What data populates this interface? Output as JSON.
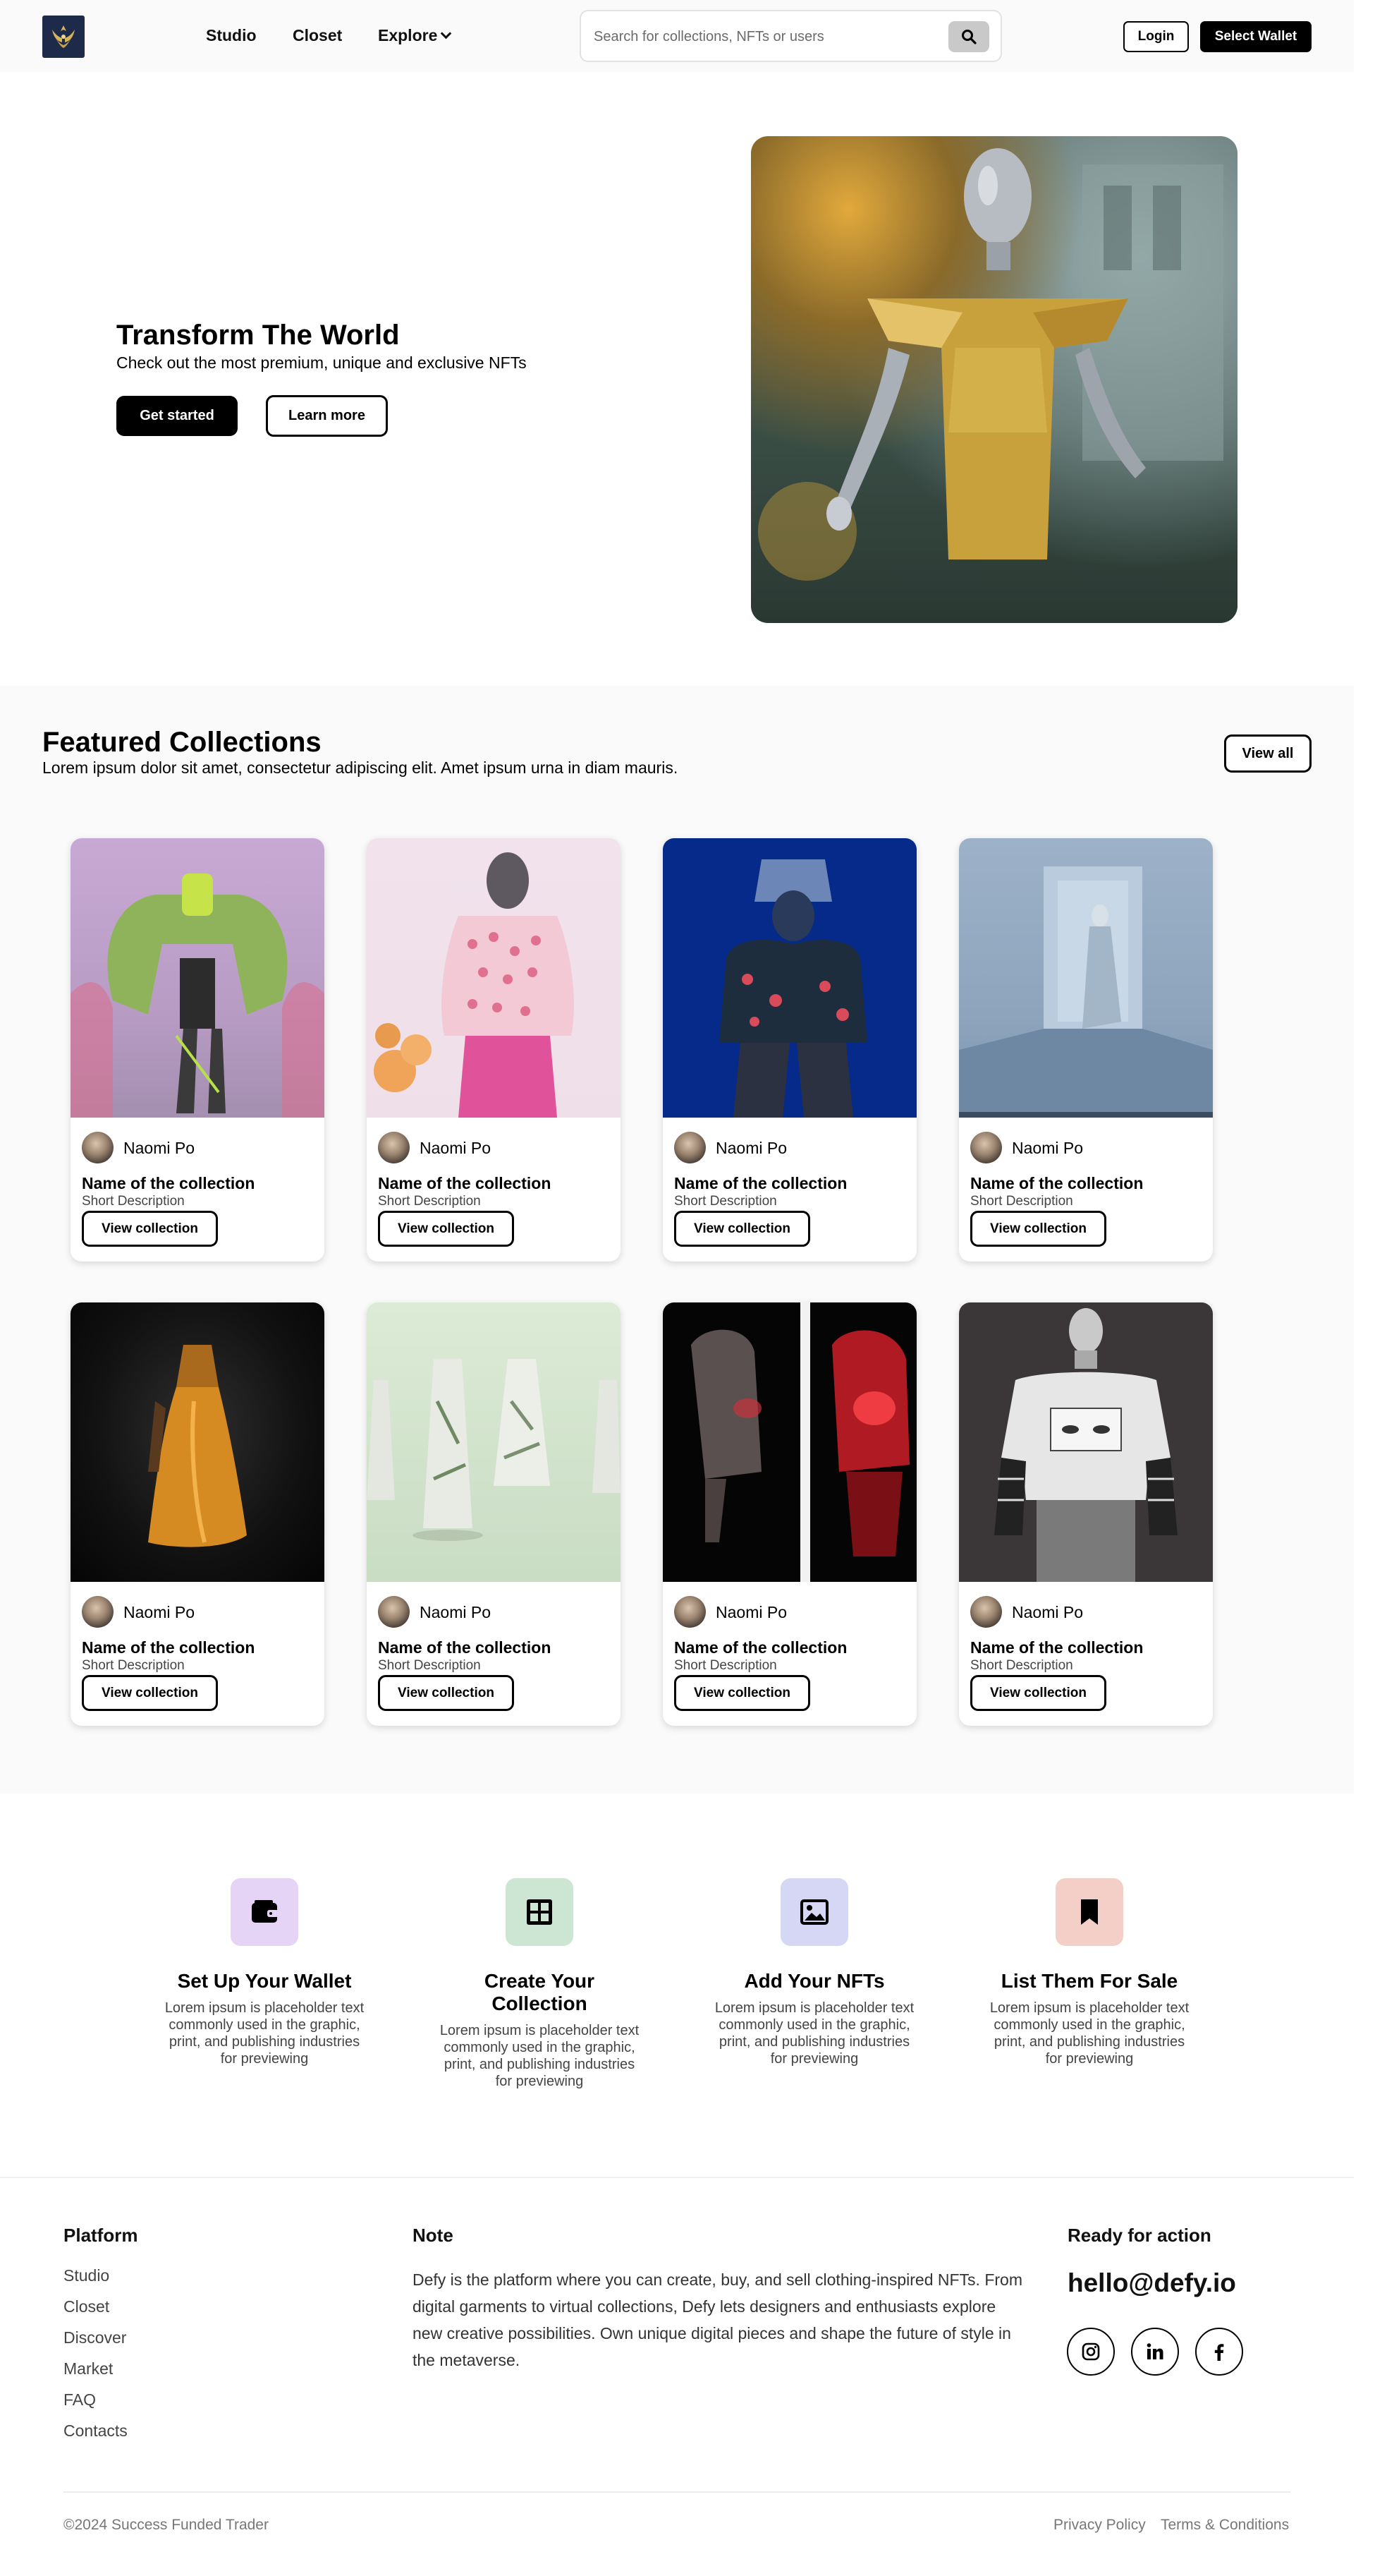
{
  "nav": {
    "links": [
      "Studio",
      "Closet",
      "Explore"
    ],
    "search_placeholder": "Search for collections, NFTs or users",
    "login_label": "Login",
    "wallet_label": "Select Wallet"
  },
  "hero": {
    "title": "Transform The World",
    "subtitle": "Check out the most premium, unique and exclusive NFTs",
    "primary_label": "Get started",
    "secondary_label": "Learn more"
  },
  "featured": {
    "title": "Featured Collections",
    "subtitle": "Lorem ipsum dolor sit amet, consectetur adipiscing elit. Amet ipsum urna in diam mauris.",
    "view_all_label": "View all",
    "cards": [
      {
        "creator": "Naomi Po",
        "name": "Name of the collection",
        "description": "Short Description",
        "button": "View collection"
      },
      {
        "creator": "Naomi Po",
        "name": "Name of the collection",
        "description": "Short Description",
        "button": "View collection"
      },
      {
        "creator": "Naomi Po",
        "name": "Name of the collection",
        "description": "Short Description",
        "button": "View collection"
      },
      {
        "creator": "Naomi Po",
        "name": "Name of the collection",
        "description": "Short Description",
        "button": "View collection"
      },
      {
        "creator": "Naomi Po",
        "name": "Name of the collection",
        "description": "Short Description",
        "button": "View collection"
      },
      {
        "creator": "Naomi Po",
        "name": "Name of the collection",
        "description": "Short Description",
        "button": "View collection"
      },
      {
        "creator": "Naomi Po",
        "name": "Name of the collection",
        "description": "Short Description",
        "button": "View collection"
      },
      {
        "creator": "Naomi Po",
        "name": "Name of the collection",
        "description": "Short Description",
        "button": "View collection"
      }
    ]
  },
  "steps": [
    {
      "title": "Set Up Your Wallet",
      "text": "Lorem ipsum is placeholder text commonly used in the graphic, print, and publishing industries for previewing",
      "icon": "wallet-icon",
      "color": "#e5d4f5"
    },
    {
      "title": "Create Your Collection",
      "text": "Lorem ipsum is placeholder text commonly used in the graphic, print, and publishing industries for previewing",
      "icon": "grid-icon",
      "color": "#cde6d3"
    },
    {
      "title": "Add Your NFTs",
      "text": "Lorem ipsum is placeholder text commonly used in the graphic, print, and publishing industries for previewing",
      "icon": "image-icon",
      "color": "#d6d7f5"
    },
    {
      "title": "List Them For Sale",
      "text": "Lorem ipsum is placeholder text commonly used in the graphic, print, and publishing industries for previewing",
      "icon": "bookmark-icon",
      "color": "#f4cfc7"
    }
  ],
  "footer": {
    "platform_heading": "Platform",
    "platform_links": [
      "Studio",
      "Closet",
      "Discover",
      "Market",
      "FAQ",
      "Contacts"
    ],
    "note_heading": "Note",
    "note_text": "Defy is the platform where you can create, buy, and sell clothing-inspired NFTs. From digital garments to virtual collections, Defy lets designers and enthusiasts explore new creative possibilities. Own unique digital pieces and shape the future of style in the metaverse.",
    "action_heading": "Ready for action",
    "email": "hello@defy.io",
    "social_icons": [
      "instagram-icon",
      "linkedin-icon",
      "facebook-icon"
    ],
    "copyright": "©2024 Success Funded Trader",
    "privacy_label": "Privacy Policy",
    "terms_label": "Terms & Conditions"
  }
}
